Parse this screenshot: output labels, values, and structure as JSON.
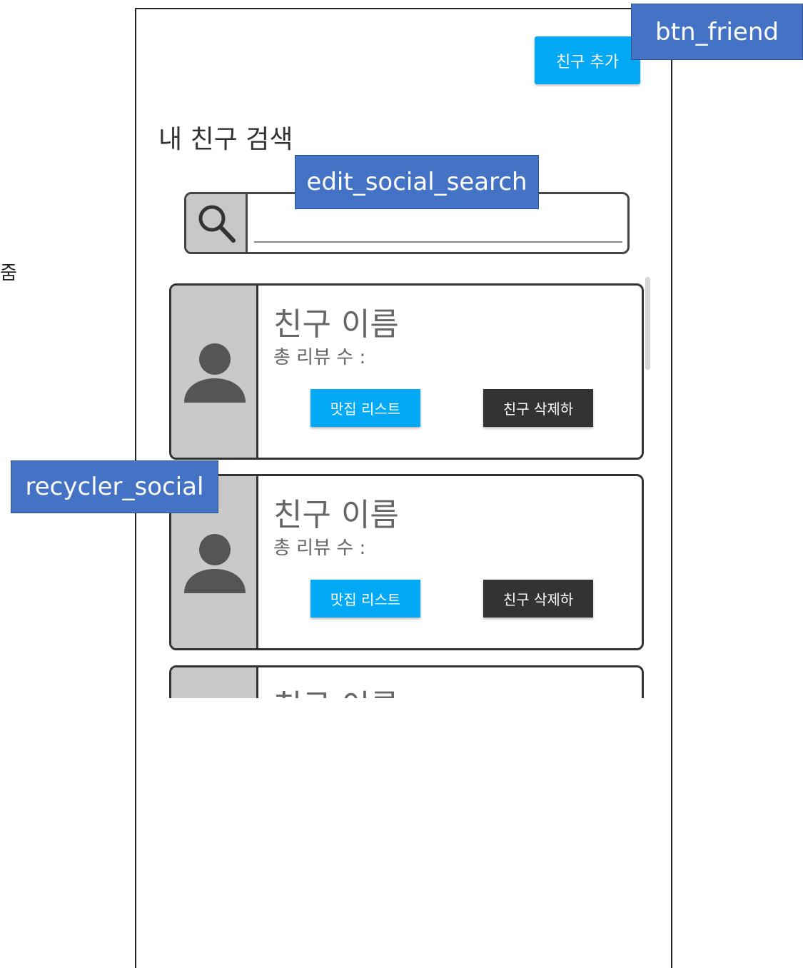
{
  "side_text": "줌",
  "header": {
    "add_friend_label": "친구 추가"
  },
  "title": "내 친구 검색",
  "search": {
    "value": "",
    "placeholder": ""
  },
  "cards": [
    {
      "name": "친구 이름",
      "review_label": "총 리뷰 수 :",
      "list_button": "맛집 리스트",
      "delete_button": "친구 삭제하"
    },
    {
      "name": "친구 이름",
      "review_label": "총 리뷰 수 :",
      "list_button": "맛집 리스트",
      "delete_button": "친구 삭제하"
    },
    {
      "name": "친구 이름"
    }
  ],
  "annotations": {
    "btn_friend": "btn_friend",
    "edit_social_search": "edit_social_search",
    "recycler_social": "recycler_social"
  },
  "colors": {
    "accent": "#03a9f4",
    "dark_button": "#333333",
    "annotation": "#4472c4"
  },
  "icons": {
    "search": "search-icon",
    "avatar": "person-icon"
  }
}
